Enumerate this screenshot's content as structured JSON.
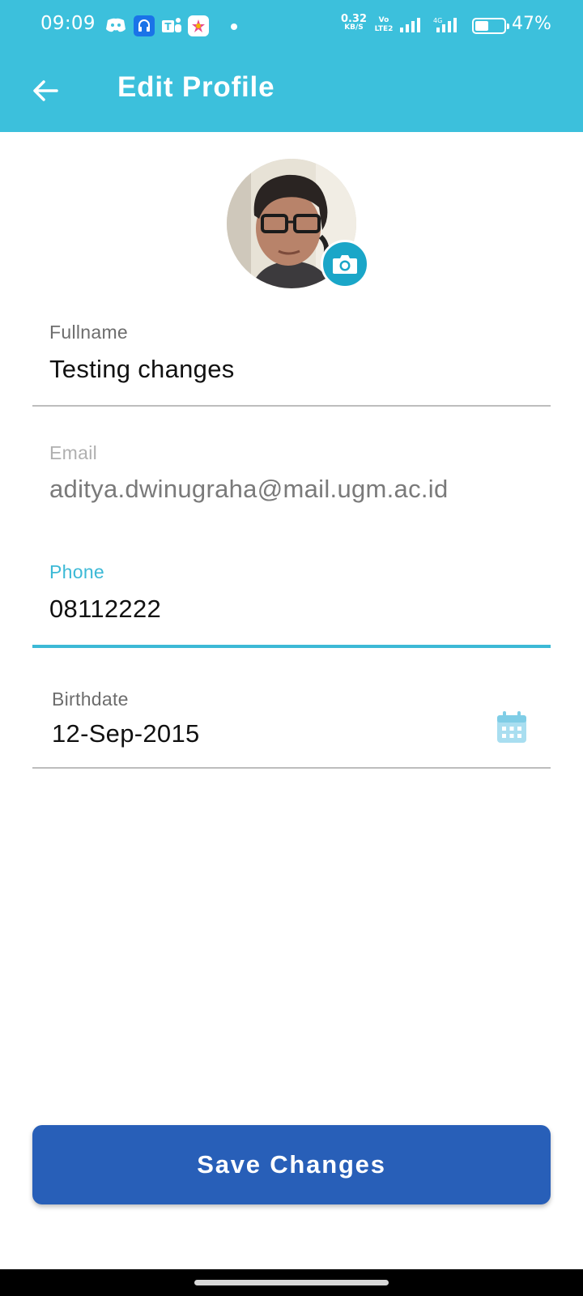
{
  "status_bar": {
    "time": "09:09",
    "net_speed_value": "0.32",
    "net_speed_unit": "KB/S",
    "volte_line1": "Vo",
    "volte_line2": "LTE2",
    "lte_tag": "4G",
    "battery_percent": "47%",
    "battery_level": 0.47,
    "notification_icons": [
      "discord-icon",
      "headset-app-icon",
      "teams-icon",
      "photos-icon"
    ]
  },
  "header": {
    "title": "Edit Profile",
    "background": "#3cc0dc"
  },
  "profile": {
    "avatar": "user-photo",
    "camera_icon": "camera-icon"
  },
  "form": {
    "fullname": {
      "label": "Fullname",
      "value": "Testing changes"
    },
    "email": {
      "label": "Email",
      "value": "aditya.dwinugraha@mail.ugm.ac.id"
    },
    "phone": {
      "label": "Phone",
      "value": "08112222",
      "state": "focused",
      "accent": "#3cb9d6"
    },
    "birthdate": {
      "label": "Birthdate",
      "value": "12-Sep-2015",
      "icon": "calendar-icon"
    }
  },
  "actions": {
    "save_label": "Save Changes",
    "save_color": "#285fb8"
  }
}
